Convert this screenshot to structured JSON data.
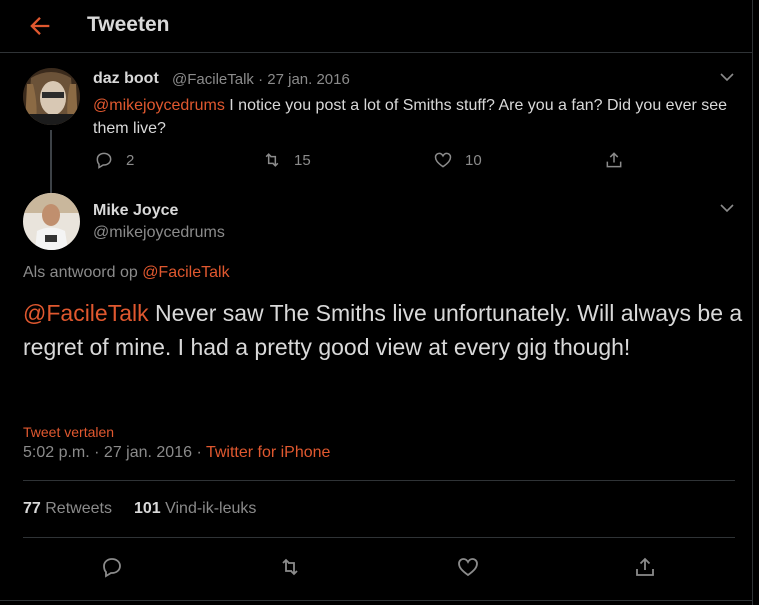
{
  "header": {
    "title": "Tweeten"
  },
  "parent": {
    "name": "daz boot",
    "handle": "@FacileTalk",
    "separator": "·",
    "date": "27 jan. 2016",
    "mention": "@mikejoycedrums",
    "text": " I notice you post a lot of Smiths stuff? Are you a fan? Did you ever see them live?",
    "replies": "2",
    "retweets": "15",
    "likes": "10"
  },
  "main": {
    "name": "Mike Joyce",
    "handle": "@mikejoycedrums",
    "reply_prefix": "Als antwoord op ",
    "reply_handle": "@FacileTalk",
    "mention": "@FacileTalk",
    "text": " Never saw The Smiths live unfortunately. Will always be a regret of mine. I had a pretty good view at every gig though!",
    "translate": "Tweet vertalen",
    "time": "5:02 p.m. · 27 jan. 2016",
    "dot": " · ",
    "source": "Twitter for iPhone",
    "retweet_count": "77",
    "retweet_label": "Retweets",
    "like_count": "101",
    "like_label": "Vind-ik-leuks"
  },
  "colors": {
    "accent": "#e0582f",
    "text": "#d9d9d9",
    "muted": "#8b8b8b",
    "border": "#2f3336",
    "background": "#000000"
  },
  "icons": [
    "back-arrow-icon",
    "chevron-down-icon",
    "reply-icon",
    "retweet-icon",
    "like-icon",
    "share-icon"
  ]
}
